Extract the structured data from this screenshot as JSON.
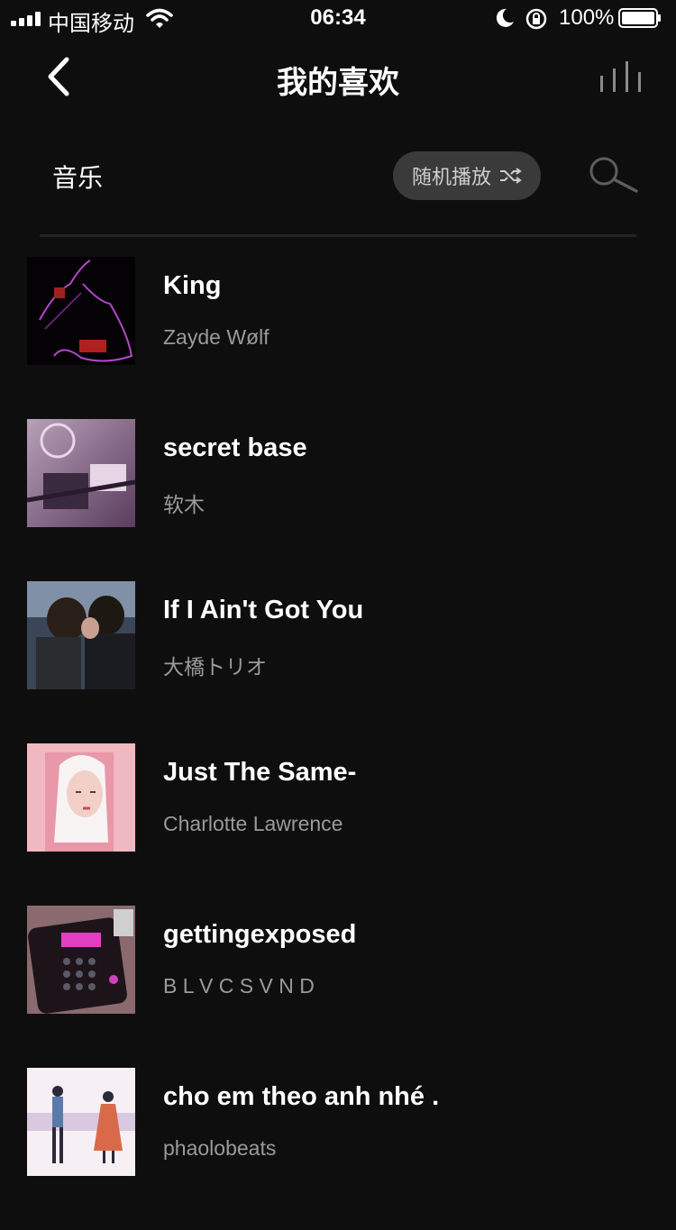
{
  "status_bar": {
    "carrier": "中国移动",
    "time": "06:34",
    "battery": "100%"
  },
  "nav": {
    "title": "我的喜欢"
  },
  "section": {
    "label": "音乐",
    "shuffle_label": "随机播放"
  },
  "songs": [
    {
      "title": "King",
      "artist": "Zayde Wølf"
    },
    {
      "title": "secret base",
      "artist": "软木"
    },
    {
      "title": "If I Ain't Got You",
      "artist": "大橋トリオ"
    },
    {
      "title": "Just The Same-",
      "artist": "Charlotte Lawrence"
    },
    {
      "title": "gettingexposed",
      "artist": "B L V C S V N D"
    },
    {
      "title": "cho em theo anh nhé .",
      "artist": "phaolobeats"
    }
  ],
  "colors": {
    "background": "#0e0e0e",
    "button_bg": "#3a3a3a",
    "secondary_text": "#9a9a9a"
  }
}
